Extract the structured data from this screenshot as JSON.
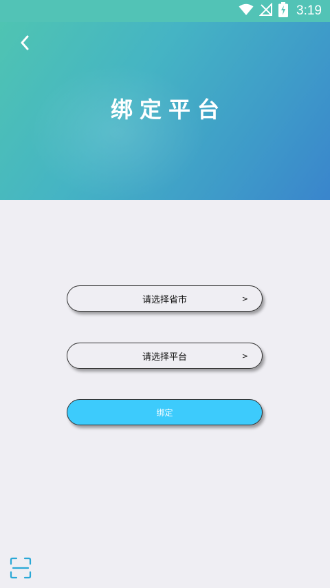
{
  "status_bar": {
    "time": "3:19",
    "icons": [
      "wifi-icon",
      "no-signal-icon",
      "battery-charging-icon"
    ]
  },
  "header": {
    "title": "绑定平台",
    "back_icon": "back-chevron-icon",
    "gradient_colors": [
      "#4fc4b2",
      "#3a85cc"
    ]
  },
  "form": {
    "province_select": {
      "placeholder": "请选择省市",
      "arrow": ">"
    },
    "platform_select": {
      "placeholder": "请选择平台",
      "arrow": ">"
    },
    "bind_button": {
      "label": "绑定",
      "color": "#3dcbfc"
    }
  },
  "footer": {
    "scan_icon": "scan-icon"
  },
  "colors": {
    "background": "#efeef3",
    "status_bar": "#52c3b6"
  }
}
